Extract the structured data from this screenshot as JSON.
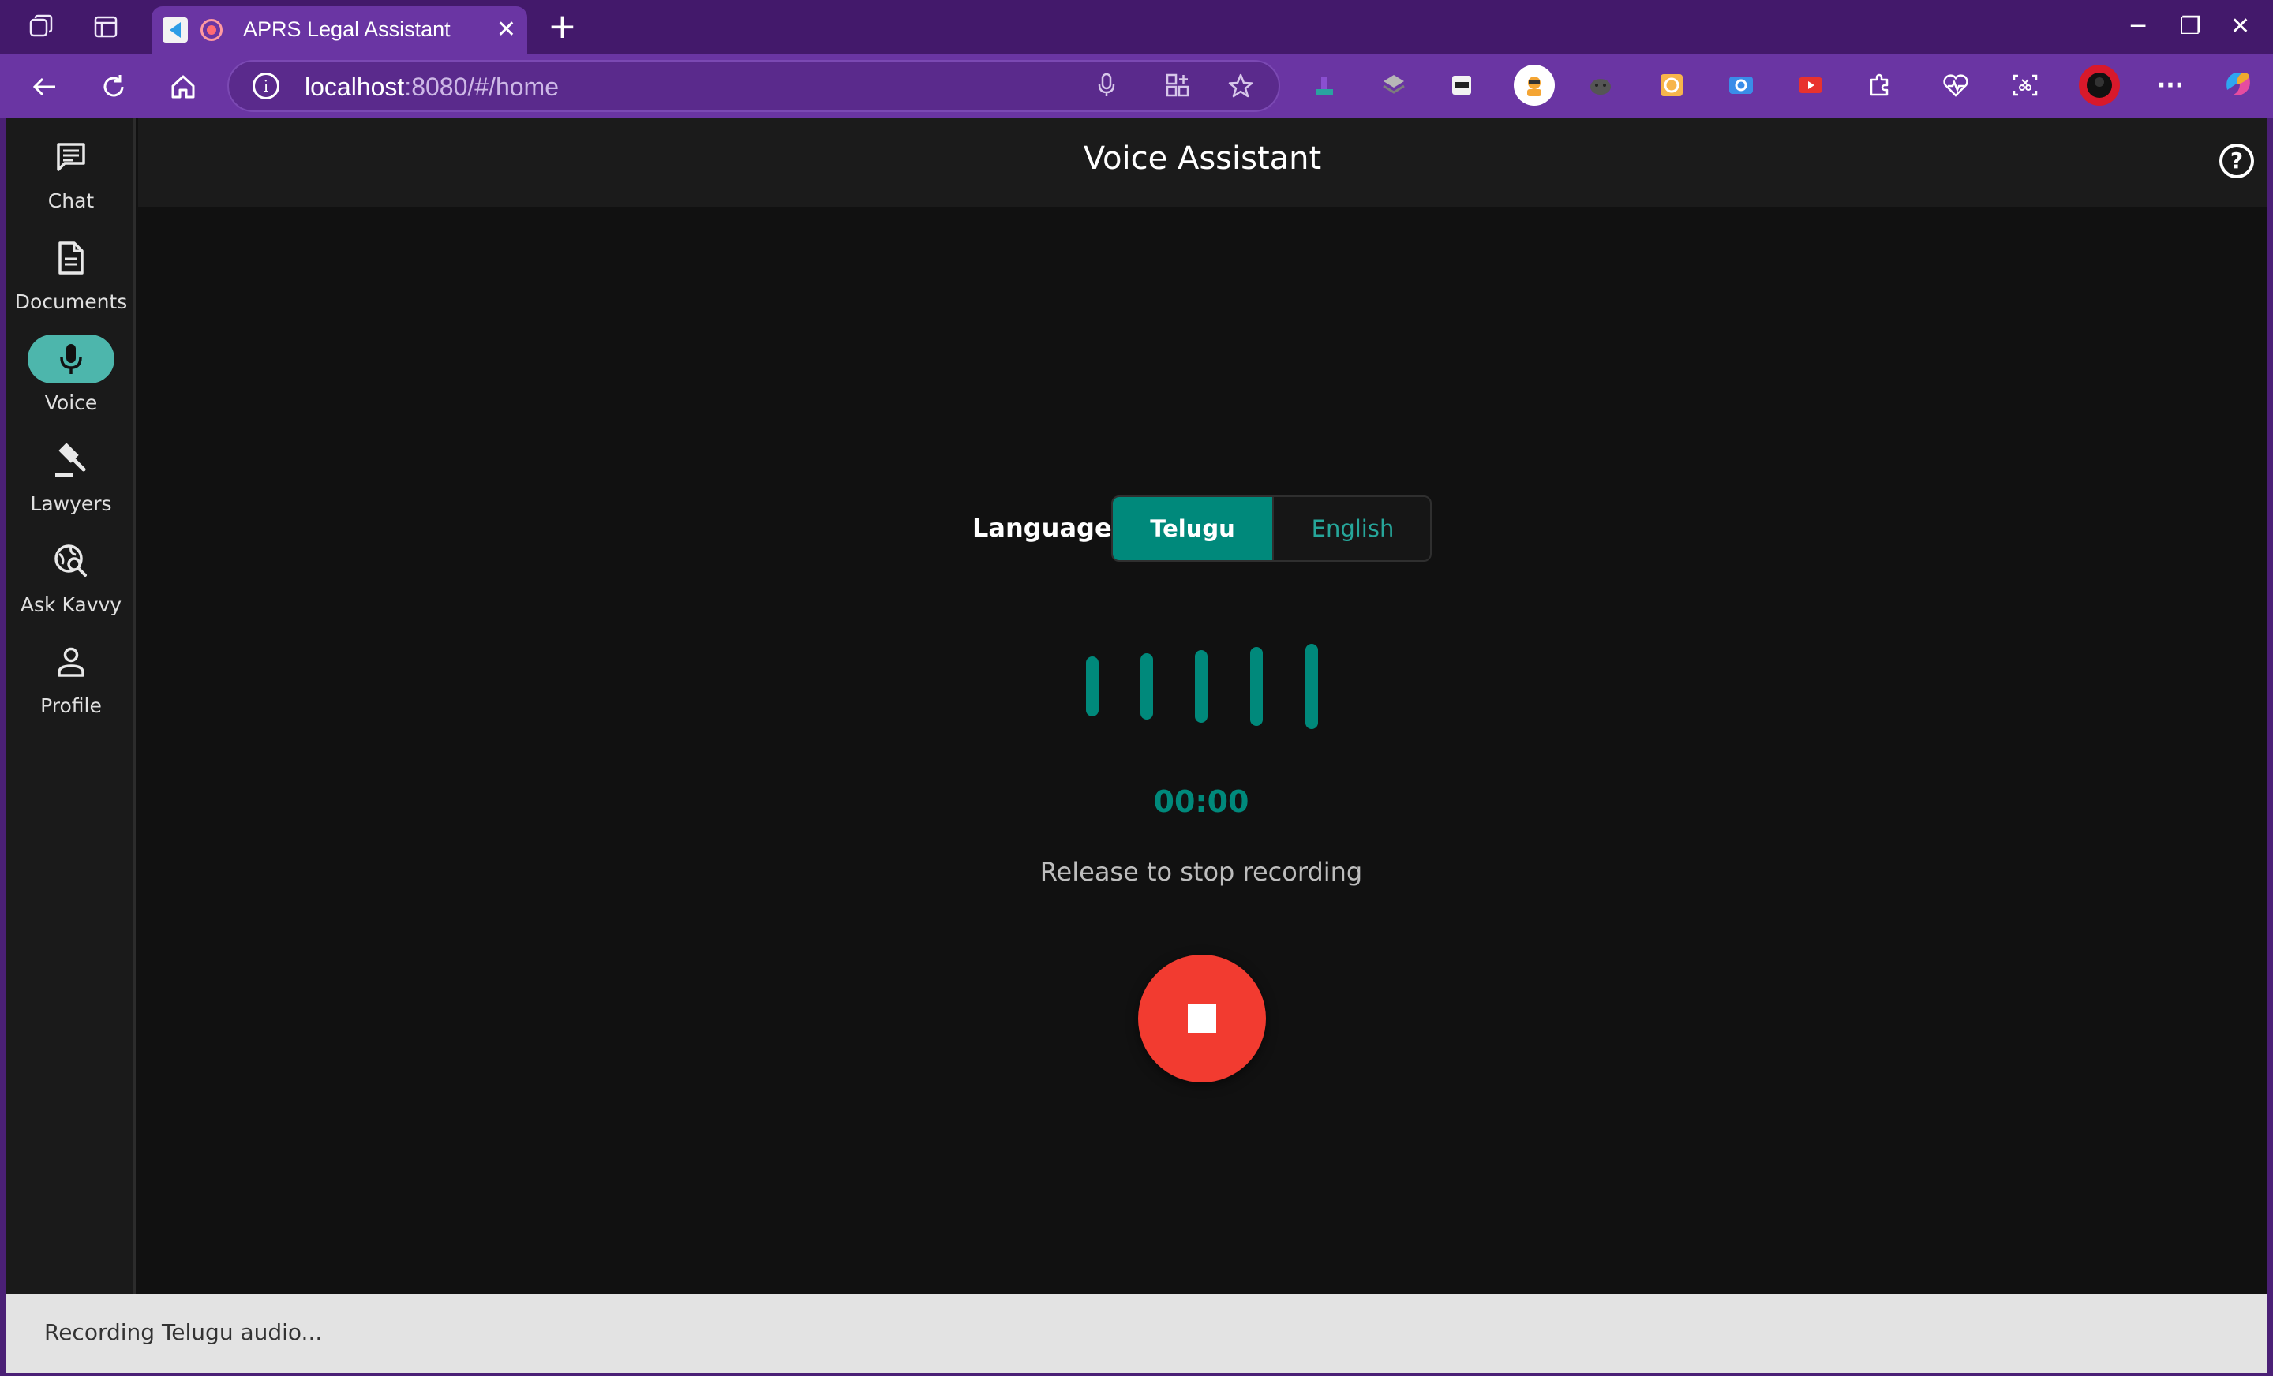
{
  "browser": {
    "tab_title": "APRS Legal Assistant",
    "tab_close": "✕",
    "new_tab": "+",
    "url_host": "localhost",
    "url_rest": ":8080/#/home",
    "window_controls": [
      "─",
      "❐",
      "✕"
    ]
  },
  "sidebar": {
    "items": [
      {
        "label": "Chat",
        "icon": "chat-icon"
      },
      {
        "label": "Documents",
        "icon": "document-icon"
      },
      {
        "label": "Voice",
        "icon": "mic-icon"
      },
      {
        "label": "Lawyers",
        "icon": "gavel-icon"
      },
      {
        "label": "Ask Kavvy",
        "icon": "search-globe-icon"
      },
      {
        "label": "Profile",
        "icon": "person-icon"
      }
    ],
    "active_index": 2
  },
  "header": {
    "title": "Voice Assistant",
    "help_symbol": "?"
  },
  "language": {
    "label": "Language:",
    "options": [
      "Telugu",
      "English"
    ],
    "selected": "Telugu"
  },
  "recorder": {
    "timer": "00:00",
    "hint": "Release to stop recording"
  },
  "snackbar": {
    "message": "Recording Telugu audio..."
  },
  "colors": {
    "accent": "#00897b",
    "accent_light": "#4db6ac",
    "stop": "#f23b30",
    "browser_chrome": "#6a35a3"
  }
}
